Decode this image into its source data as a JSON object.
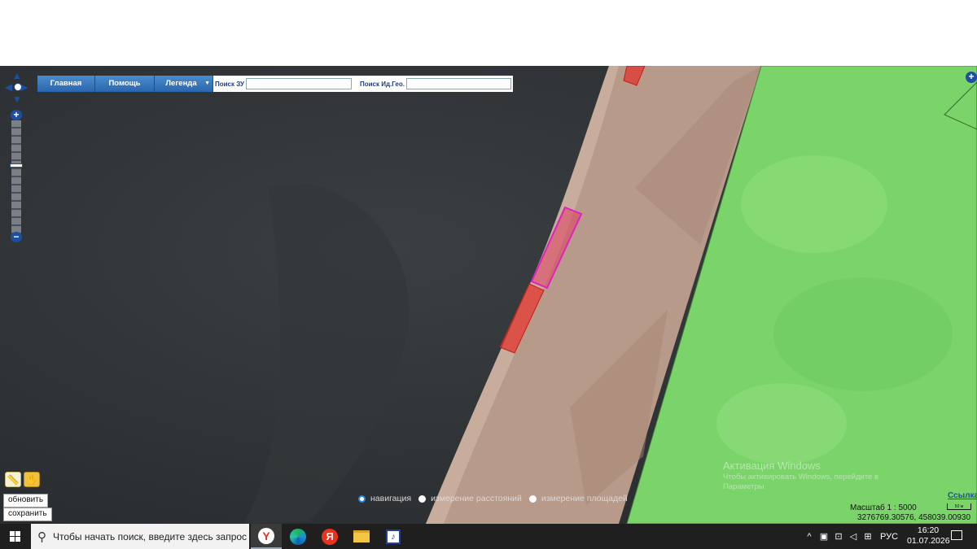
{
  "toolbar": {
    "main_label": "Главная",
    "help_label": "Помощь",
    "legend_label": "Легенда",
    "search_zu_label": "Поиск ЗУ",
    "search_zu_value": "",
    "search_geo_label": "Поиск Ид.Гео.",
    "search_geo_value": ""
  },
  "zoom": {
    "plus": "+",
    "minus": "−",
    "add_layer": "+"
  },
  "buttons": {
    "refresh": "обновить",
    "save": "сохранить"
  },
  "modes": [
    {
      "label": "навигация",
      "selected": true
    },
    {
      "label": "измерение расстояний",
      "selected": false
    },
    {
      "label": "измерение площадей",
      "selected": false
    }
  ],
  "watermark": {
    "title": "Активация Windows",
    "line1": "Чтобы активировать Windows, перейдите в",
    "line2": "Параметры"
  },
  "map_info": {
    "scale_label": "Масштаб 1 : 5000",
    "scale_bar_label": "50 м",
    "link": "Ссылка",
    "coordinates": "3276769.30576, 458039.00930"
  },
  "taskbar": {
    "search_placeholder": "Чтобы начать поиск, введите здесь запрос",
    "yandex_letter": "Я",
    "language": "РУС",
    "time": "16:20",
    "date": "01.07.2026"
  },
  "colors": {
    "water": "#2c3033",
    "shore": "#b7998a",
    "green_zone": "#7cd36b",
    "parcel_red": "#e0342c",
    "parcel_highlight": "#e020c0",
    "accent": "#1e4fa0"
  }
}
